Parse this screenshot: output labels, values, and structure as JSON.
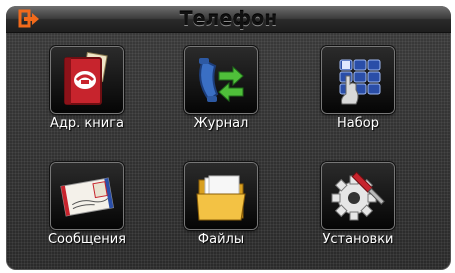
{
  "header": {
    "title": "Телефон",
    "back_icon": "exit-icon"
  },
  "tiles": [
    {
      "label": "Адр. книга",
      "icon": "address-book-icon"
    },
    {
      "label": "Журнал",
      "icon": "call-log-icon"
    },
    {
      "label": "Набор",
      "icon": "dial-keypad-icon"
    },
    {
      "label": "Сообщения",
      "icon": "envelope-icon"
    },
    {
      "label": "Файлы",
      "icon": "folder-icon"
    },
    {
      "label": "Установки",
      "icon": "settings-tools-icon"
    }
  ],
  "colors": {
    "accent": "#f26a1b",
    "background": "#2e2e2e",
    "text": "#ffffff"
  }
}
